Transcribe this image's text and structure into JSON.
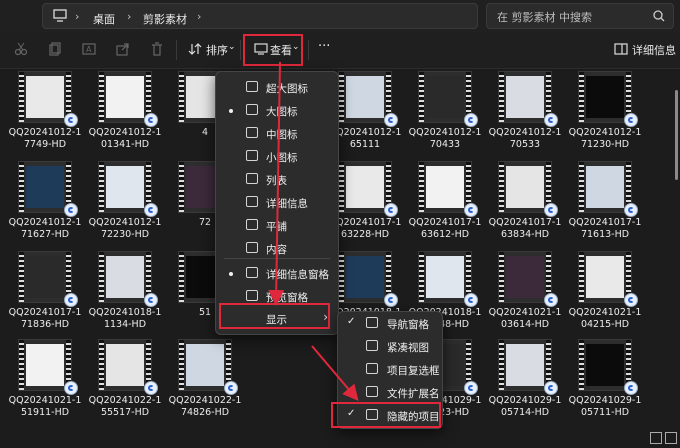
{
  "address": {
    "crumbs": [
      "桌面",
      "剪影素材"
    ],
    "search_placeholder": "在 剪影素材 中搜索"
  },
  "toolbar": {
    "sort_label": "排序",
    "view_label": "查看",
    "more_label": "···",
    "details_label": "详细信息"
  },
  "view_menu": {
    "items": [
      {
        "label": "超大图标",
        "selected": false
      },
      {
        "label": "大图标",
        "selected": true
      },
      {
        "label": "中图标",
        "selected": false
      },
      {
        "label": "小图标",
        "selected": false
      },
      {
        "label": "列表",
        "selected": false
      },
      {
        "label": "详细信息",
        "selected": false
      },
      {
        "label": "平铺",
        "selected": false
      },
      {
        "label": "内容",
        "selected": false
      },
      {
        "label": "详细信息窗格",
        "selected": true
      },
      {
        "label": "预览窗格",
        "selected": false
      },
      {
        "label": "显示",
        "selected": false
      }
    ],
    "submenu_arrow": "›"
  },
  "show_submenu": {
    "items": [
      {
        "label": "导航窗格",
        "checked": true
      },
      {
        "label": "紧凑视图",
        "checked": false
      },
      {
        "label": "项目复选框",
        "checked": false
      },
      {
        "label": "文件扩展名",
        "checked": false
      },
      {
        "label": "隐藏的项目",
        "checked": true
      }
    ]
  },
  "files": [
    {
      "name": "QQ20241012-1\n7749-HD"
    },
    {
      "name": "QQ20241012-1\n01341-HD"
    },
    {
      "name": "4"
    },
    {
      "name": "QQ20241012-1\n65111"
    },
    {
      "name": "QQ20241012-1\n70433"
    },
    {
      "name": "QQ20241012-1\n70533"
    },
    {
      "name": "QQ20241012-1\n71230-HD"
    },
    {
      "name": "QQ20241012-1\n71627-HD"
    },
    {
      "name": "QQ20241012-1\n72230-HD"
    },
    {
      "name": "72"
    },
    {
      "name": "QQ20241017-1\n63228-HD"
    },
    {
      "name": "QQ20241017-1\n63612-HD"
    },
    {
      "name": "QQ20241017-1\n63834-HD"
    },
    {
      "name": "QQ20241017-1\n71613-HD"
    },
    {
      "name": "QQ20241017-1\n71836-HD"
    },
    {
      "name": "QQ20241018-1\n1134-HD"
    },
    {
      "name": "51"
    },
    {
      "name": "QQ20241018-1\n71239-HD"
    },
    {
      "name": "QQ20241018-1\n72148-HD"
    },
    {
      "name": "QQ20241021-1\n03614-HD"
    },
    {
      "name": "QQ20241021-1\n04215-HD"
    },
    {
      "name": "QQ20241021-1\n51911-HD"
    },
    {
      "name": "QQ20241022-1\n55517-HD"
    },
    {
      "name": "QQ20241022-1\n74826-HD"
    },
    {
      "name": "QQ20241029-1\n55823-HD"
    },
    {
      "name": "QQ20241029-1\n05714-HD"
    },
    {
      "name": "QQ20241029-1\n05711-HD"
    }
  ],
  "colors": {
    "highlight": "#e0283c",
    "bg": "#1c1c1c",
    "menu": "#2c2c2c"
  }
}
